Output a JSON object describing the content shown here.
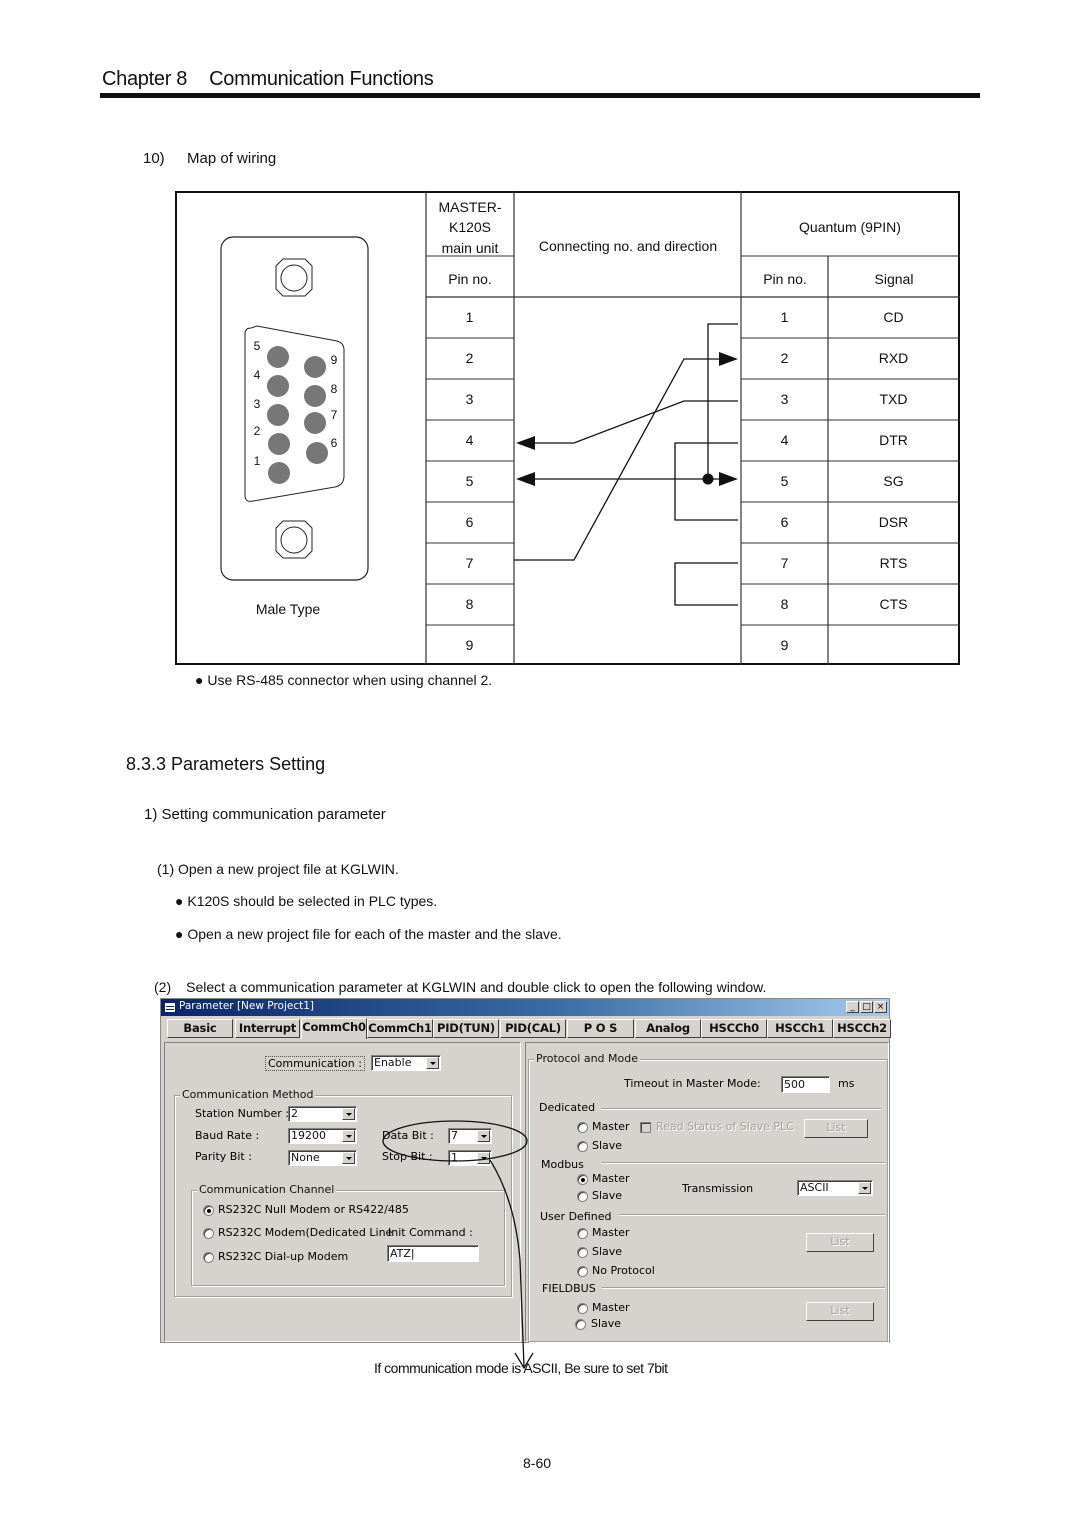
{
  "header": {
    "chapter": "Chapter 8",
    "title": "Communication Functions"
  },
  "wiring": {
    "heading_num": "10)",
    "heading": "Map of wiring",
    "connector_caption": "Male Type",
    "connector_pins_left": [
      "5",
      "4",
      "3",
      "2",
      "1"
    ],
    "connector_pins_right": [
      "9",
      "8",
      "7",
      "6"
    ],
    "master_header": [
      "MASTER-",
      "K120S",
      "main unit"
    ],
    "master_pin_header": "Pin no.",
    "direction_header": "Connecting no. and direction",
    "quantum_header": "Quantum (9PIN)",
    "quantum_pin_header": "Pin no.",
    "quantum_signal_header": "Signal",
    "master_pins": [
      "1",
      "2",
      "3",
      "4",
      "5",
      "6",
      "7",
      "8",
      "9"
    ],
    "quantum_pins": [
      "1",
      "2",
      "3",
      "4",
      "5",
      "6",
      "7",
      "8",
      "9"
    ],
    "quantum_signals": [
      "CD",
      "RXD",
      "TXD",
      "DTR",
      "SG",
      "DSR",
      "RTS",
      "CTS",
      ""
    ],
    "note": "Use RS-485 connector when using channel 2."
  },
  "section": {
    "title": "8.3.3 Parameters Setting",
    "sub": "1) Setting communication parameter",
    "step1": "(1) Open a new project file at KGLWIN.",
    "bullet1": "K120S should be selected in PLC types.",
    "bullet2": "Open a new project file for each of the master and the slave.",
    "step2_num": "(2)",
    "step2": "Select a communication parameter at KGLWIN and double click to open the following window."
  },
  "window": {
    "title": "Parameter [New Project1]",
    "tabs": [
      "Basic",
      "Interrupt",
      "CommCh0",
      "CommCh1",
      "PID(TUN)",
      "PID(CAL)",
      "P O S",
      "Analog",
      "HSCCh0",
      "HSCCh1",
      "HSCCh2"
    ],
    "active_tab": "CommCh0",
    "communication_label": "Communication :",
    "communication_value": "Enable",
    "method_group": "Communication Method",
    "station_label": "Station Number :",
    "station_value": "2",
    "baud_label": "Baud Rate :",
    "baud_value": "19200",
    "parity_label": "Parity Bit :",
    "parity_value": "None",
    "databit_label": "Data Bit :",
    "databit_value": "7",
    "stopbit_label": "Stop Bit :",
    "stopbit_value": "1",
    "channel_group": "Communication Channel",
    "channel_options": [
      "RS232C Null Modem or RS422/485",
      "RS232C Modem(Dedicated Line",
      "RS232C Dial-up Modem"
    ],
    "channel_selected": 0,
    "init_label": "Init Command :",
    "init_value": "ATZ|",
    "protocol_group": "Protocol and Mode",
    "timeout_label": "Timeout in Master Mode:",
    "timeout_value": "500",
    "timeout_unit": "ms",
    "dedicated_label": "Dedicated",
    "dedicated_master": "Master",
    "dedicated_slave": "Slave",
    "read_status_label": "Read Status of Slave PLC",
    "list_label": "List",
    "modbus_label": "Modbus",
    "modbus_master": "Master",
    "modbus_slave": "Slave",
    "transmission_label": "Transmission",
    "transmission_value": "ASCII",
    "user_defined_label": "User Defined",
    "ud_master": "Master",
    "ud_slave": "Slave",
    "ud_noprotocol": "No Protocol",
    "fieldbus_label": "FIELDBUS",
    "fb_master": "Master",
    "fb_slave": "Slave"
  },
  "annotation": "If communication mode is ASCII, Be sure to set 7bit",
  "page_number": "8-60"
}
